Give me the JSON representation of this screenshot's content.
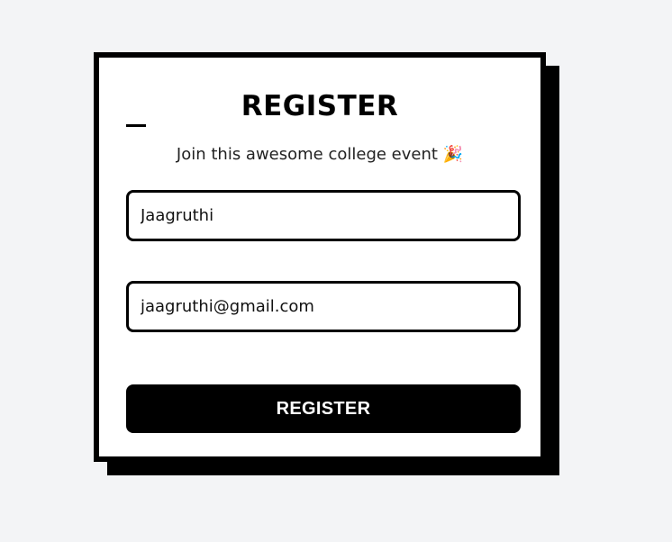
{
  "form": {
    "title": "REGISTER",
    "subtitle": "Join this awesome college event 🎉",
    "name_value": "Jaagruthi",
    "email_value": "jaagruthi@gmail.com",
    "submit_label": "REGISTER"
  },
  "colors": {
    "background": "#f3f4f6",
    "card": "#ffffff",
    "border": "#000000",
    "button": "#000000",
    "button_text": "#ffffff"
  }
}
